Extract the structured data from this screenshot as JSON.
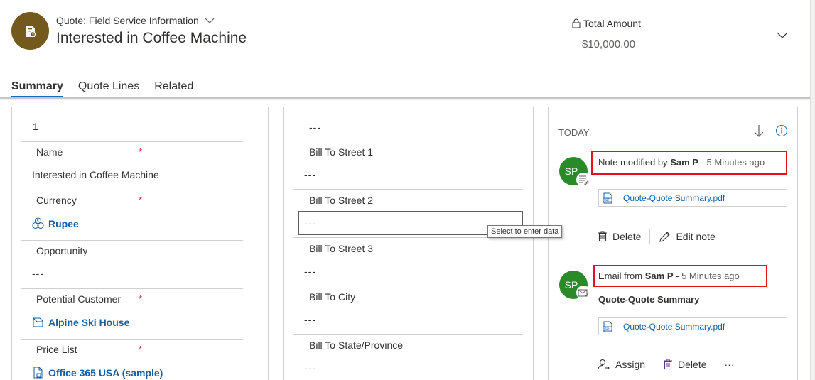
{
  "header": {
    "entity_type": "Quote: Field Service Information",
    "record_title": "Interested in Coffee Machine",
    "total_label": "Total Amount",
    "total_value": "$10,000.00"
  },
  "tabs": [
    {
      "label": "Summary",
      "active": true
    },
    {
      "label": "Quote Lines",
      "active": false
    },
    {
      "label": "Related",
      "active": false
    }
  ],
  "left_column": {
    "top_value": "1",
    "fields": [
      {
        "label": "Name",
        "required": true,
        "value": "Interested in Coffee Machine",
        "type": "text"
      },
      {
        "label": "Currency",
        "required": true,
        "value": "Rupee",
        "type": "lookup",
        "icon": "currency-icon"
      },
      {
        "label": "Opportunity",
        "required": false,
        "value": "---",
        "type": "empty"
      },
      {
        "label": "Potential Customer",
        "required": true,
        "value": "Alpine Ski House",
        "type": "lookup",
        "icon": "account-icon"
      },
      {
        "label": "Price List",
        "required": true,
        "value": "Office 365 USA (sample)",
        "type": "lookup",
        "icon": "price-list-icon"
      }
    ]
  },
  "middle_column": {
    "top_value": "---",
    "fields": [
      {
        "label": "Bill To Street 1",
        "value": "---"
      },
      {
        "label": "Bill To Street 2",
        "value": "---",
        "focused": true
      },
      {
        "label": "Bill To Street 3",
        "value": "---"
      },
      {
        "label": "Bill To City",
        "value": "---"
      },
      {
        "label": "Bill To State/Province",
        "value": "---"
      }
    ],
    "tooltip": "Select to enter data"
  },
  "timeline": {
    "group_label": "TODAY",
    "items": [
      {
        "initials": "SP",
        "kind": "note",
        "prefix": "Note modified by",
        "author": "Sam P",
        "separator": "-",
        "time": "5 Minutes ago",
        "attachment": "Quote-Quote Summary.pdf",
        "actions": [
          "Delete",
          "Edit note"
        ]
      },
      {
        "initials": "SP",
        "kind": "email",
        "prefix": "Email from",
        "author": "Sam P",
        "separator": "-",
        "time": "5 Minutes ago",
        "subject": "Quote-Quote Summary",
        "attachment": "Quote-Quote Summary.pdf",
        "actions": [
          "Assign",
          "Delete",
          "···"
        ]
      }
    ]
  },
  "colors": {
    "entity_avatar": "#735a1c",
    "user_avatar": "#2a8a2a",
    "link": "#115ea3",
    "highlight": "#e3101f",
    "tab_underline": "#0f6cbd",
    "required": "#d13438"
  }
}
